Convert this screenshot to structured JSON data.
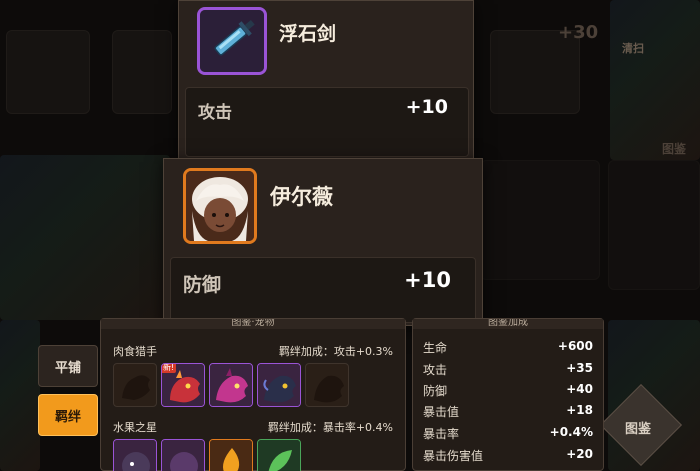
{
  "background": {
    "plus_value": "+30",
    "right_label": "图鉴",
    "right_badge": "清扫"
  },
  "weapon_card": {
    "name": "浮石剑",
    "stat_label": "攻击",
    "stat_value": "+10",
    "icon": "blue-sword-icon"
  },
  "hero_card": {
    "name": "伊尔薇",
    "stat_label": "防御",
    "stat_value": "+10",
    "icon": "white-haired-hero-portrait"
  },
  "side_tabs": [
    {
      "label": "平铺",
      "active": false
    },
    {
      "label": "羁绊",
      "active": true
    }
  ],
  "collection_panel": {
    "header": "图鉴·宠物",
    "groups": [
      {
        "name": "肉食猎手",
        "bonus": "羁绊加成：攻击+0.3%",
        "badge": "新!"
      },
      {
        "name": "水果之星",
        "bonus": "羁绊加成：暴击率+0.4%"
      }
    ]
  },
  "bonus_panel": {
    "header": "图鉴加成",
    "stats": [
      {
        "label": "生命",
        "value": "+600"
      },
      {
        "label": "攻击",
        "value": "+35"
      },
      {
        "label": "防御",
        "value": "+40"
      },
      {
        "label": "暴击值",
        "value": "+18"
      },
      {
        "label": "暴击率",
        "value": "+0.4%"
      },
      {
        "label": "暴击伤害值",
        "value": "+20"
      }
    ]
  },
  "colors": {
    "accent_orange": "#f29a1c",
    "rare_purple": "#9a54d6",
    "epic_orange": "#e07a1e"
  }
}
